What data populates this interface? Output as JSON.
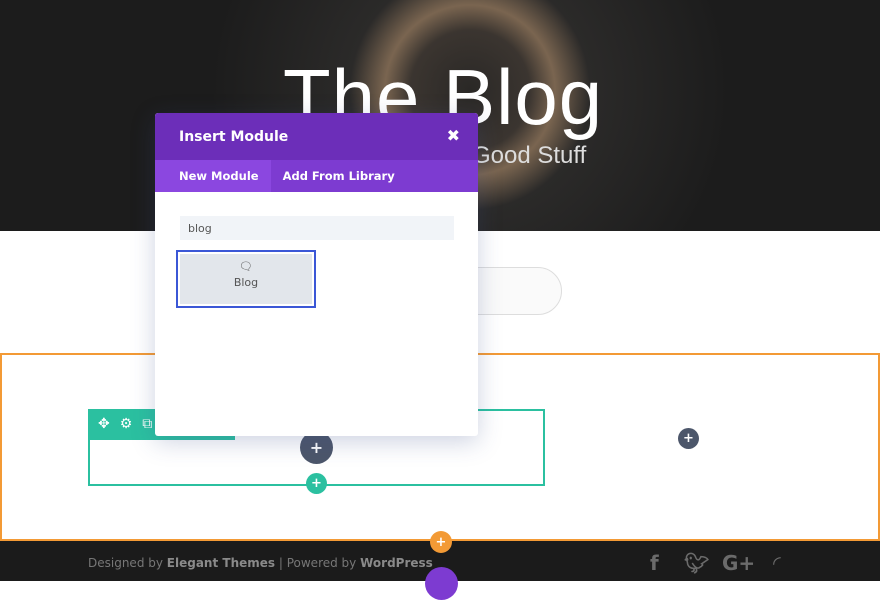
{
  "hero": {
    "title": "The Blog",
    "subtitle": "Good Stuff"
  },
  "modal": {
    "title": "Insert Module",
    "close_icon": "close-icon",
    "tabs": [
      {
        "label": "New Module",
        "active": true
      },
      {
        "label": "Add From Library",
        "active": false
      }
    ],
    "search_value": "blog",
    "results": [
      {
        "label": "Blog",
        "icon": "comments-icon"
      }
    ]
  },
  "footer": {
    "designed_by": "Designed by",
    "elegant": "Elegant Themes",
    "sep": " | Powered by ",
    "wordpress": "WordPress",
    "social": [
      "facebook",
      "twitter",
      "google-plus",
      "rss"
    ]
  },
  "colors": {
    "section": "#f39a35",
    "row": "#2bc0a0",
    "modal_header": "#6c2eb9",
    "selected": "#3b57d6"
  }
}
